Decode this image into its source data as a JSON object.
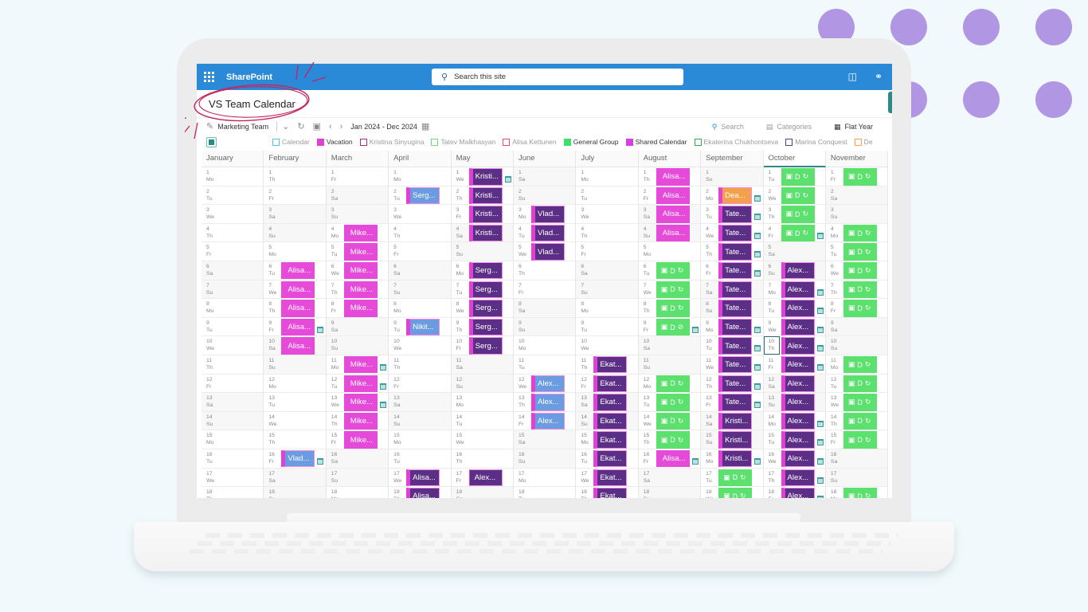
{
  "colors": {
    "suitebar": "#2a8ad8",
    "vacation": "#e64ad8",
    "personal_event": "#5b2f85",
    "shared_event": "#6b9be0",
    "deadline": "#f4a04b",
    "general_group": "#5ce06e",
    "accent_teal": "#2b8a86",
    "decor_dot": "#b197e3",
    "annotation": "#c4245e"
  },
  "suitebar": {
    "app_name": "SharePoint",
    "search_placeholder": "Search this site",
    "icons": [
      "waffle-icon",
      "megaphone-icon",
      "share-icon"
    ]
  },
  "page": {
    "title": "VS Team Calendar"
  },
  "toolbar": {
    "calendar_name": "Marketing Team",
    "date_range": "Jan 2024 - Dec 2024",
    "search_label": "Search",
    "categories_label": "Categories",
    "view_label": "Flat Year"
  },
  "legend": [
    {
      "label": "Calendar",
      "color": "#4dc6e0",
      "filled": false,
      "active": false
    },
    {
      "label": "Vacation",
      "color": "#e23fd6",
      "filled": true,
      "active": true
    },
    {
      "label": "Kristina Sinyugina",
      "color": "#a0307f",
      "filled": false,
      "active": false
    },
    {
      "label": "Tatev Malkhasyan",
      "color": "#6ddc7a",
      "filled": false,
      "active": false
    },
    {
      "label": "Alisa Kettunen",
      "color": "#e05060",
      "filled": false,
      "active": false
    },
    {
      "label": "General Group",
      "color": "#3fe06a",
      "filled": true,
      "active": true
    },
    {
      "label": "Shared Calendar",
      "color": "#d83ee8",
      "filled": true,
      "active": true
    },
    {
      "label": "Ekaterina Chukhontseva",
      "color": "#3aa64a",
      "filled": false,
      "active": false
    },
    {
      "label": "Marina Conquest",
      "color": "#5a3b86",
      "filled": false,
      "active": false
    },
    {
      "label": "De",
      "color": "#f4a04b",
      "filled": false,
      "active": false
    }
  ],
  "calendar": {
    "current_month_index": 9,
    "today": {
      "month": 9,
      "day": 10
    },
    "visible_days": 18,
    "months": [
      {
        "name": "January",
        "first_weekday": 0,
        "events": []
      },
      {
        "name": "February",
        "first_weekday": 3,
        "events": [
          {
            "days": [
              6,
              7,
              8,
              9,
              10
            ],
            "title": "Alisa...",
            "type": "vac",
            "icon_days": [
              9
            ]
          },
          {
            "days": [
              16
            ],
            "title": "Vlad...",
            "type": "blu",
            "icon_days": [
              16
            ]
          }
        ]
      },
      {
        "name": "March",
        "first_weekday": 4,
        "events": [
          {
            "days": [
              4,
              5,
              6,
              7,
              8
            ],
            "title": "Mike...",
            "type": "vac",
            "icon_days": []
          },
          {
            "days": [
              11,
              12,
              13,
              14,
              15
            ],
            "title": "Mike...",
            "type": "vac",
            "icon_days": [
              11,
              12,
              13
            ]
          }
        ]
      },
      {
        "name": "April",
        "first_weekday": 0,
        "events": [
          {
            "days": [
              2
            ],
            "title": "Serg...",
            "type": "blu",
            "icon_days": []
          },
          {
            "days": [
              9
            ],
            "title": "Nikit...",
            "type": "blu",
            "icon_days": []
          },
          {
            "days": [
              17,
              18
            ],
            "title": "Alisa...",
            "type": "pur",
            "icon_days": []
          }
        ]
      },
      {
        "name": "May",
        "first_weekday": 2,
        "events": [
          {
            "days": [
              1,
              2,
              3,
              4
            ],
            "title": "Kristi...",
            "type": "pur",
            "icon_days": [
              1
            ]
          },
          {
            "days": [
              6,
              7,
              8,
              9,
              10
            ],
            "title": "Serg...",
            "type": "pur",
            "icon_days": []
          },
          {
            "days": [
              17
            ],
            "title": "Alex...",
            "type": "pur-nostripe",
            "icon_days": []
          }
        ]
      },
      {
        "name": "June",
        "first_weekday": 5,
        "events": [
          {
            "days": [
              3,
              4,
              5
            ],
            "title": "Vlad...",
            "type": "pur",
            "icon_days": []
          },
          {
            "days": [
              12,
              13,
              14
            ],
            "title": "Alex...",
            "type": "blu",
            "icon_days": []
          }
        ]
      },
      {
        "name": "July",
        "first_weekday": 0,
        "events": [
          {
            "days": [
              11,
              12,
              13,
              14,
              15,
              16,
              17,
              18
            ],
            "title": "Ekat...",
            "type": "pur",
            "icon_days": []
          }
        ]
      },
      {
        "name": "August",
        "first_weekday": 3,
        "events": [
          {
            "days": [
              1,
              2,
              3,
              4
            ],
            "title": "Alisa...",
            "type": "vac",
            "icon_days": []
          },
          {
            "days": [
              6,
              7,
              8,
              9
            ],
            "title": "",
            "type": "grn",
            "icon_days": [
              9
            ],
            "sync_off_days": [
              9
            ]
          },
          {
            "days": [
              12,
              13,
              14,
              15
            ],
            "title": "",
            "type": "grn",
            "icon_days": []
          },
          {
            "days": [
              16
            ],
            "title": "Alisa...",
            "type": "vac",
            "icon_days": [
              16
            ]
          }
        ]
      },
      {
        "name": "September",
        "first_weekday": 6,
        "events": [
          {
            "days": [
              2
            ],
            "title": "Dea...",
            "type": "org",
            "icon_days": [
              2
            ]
          },
          {
            "days": [
              3,
              4,
              5,
              6,
              7,
              8,
              9,
              10,
              11,
              12,
              13
            ],
            "title": "Tate...",
            "type": "pur",
            "icon_days": [
              3,
              4,
              5,
              6,
              9,
              10,
              11,
              12,
              13
            ]
          },
          {
            "days": [
              14,
              15,
              16
            ],
            "title": "Kristi...",
            "type": "pur",
            "icon_days": [
              16
            ]
          },
          {
            "days": [
              17,
              18
            ],
            "title": "",
            "type": "grn",
            "icon_days": []
          }
        ]
      },
      {
        "name": "October",
        "first_weekday": 1,
        "events": [
          {
            "days": [
              1,
              2,
              3,
              4
            ],
            "title": "",
            "type": "grn",
            "icon_days": [
              4
            ]
          },
          {
            "days": [
              6,
              7,
              8,
              9,
              10,
              11,
              12,
              13,
              14,
              15,
              16,
              17,
              18
            ],
            "title": "Alex...",
            "type": "pur",
            "icon_days": [
              7,
              8,
              9,
              10,
              11,
              14,
              15,
              16,
              17,
              18
            ]
          }
        ]
      },
      {
        "name": "November",
        "first_weekday": 4,
        "events": [
          {
            "days": [
              1
            ],
            "title": "",
            "type": "grn",
            "icon_days": []
          },
          {
            "days": [
              4,
              5,
              6,
              7,
              8
            ],
            "title": "",
            "type": "grn",
            "icon_days": []
          },
          {
            "days": [
              11,
              12,
              13,
              14,
              15
            ],
            "title": "",
            "type": "grn",
            "icon_days": []
          },
          {
            "days": [
              18
            ],
            "title": "",
            "type": "grn",
            "icon_days": []
          }
        ]
      }
    ],
    "weekday_abbr": [
      "Mo",
      "Tu",
      "We",
      "Th",
      "Fr",
      "Sa",
      "Su"
    ],
    "green_event_glyphs": {
      "teams": "teams-icon",
      "letter": "D",
      "sync": "sync-icon"
    }
  }
}
